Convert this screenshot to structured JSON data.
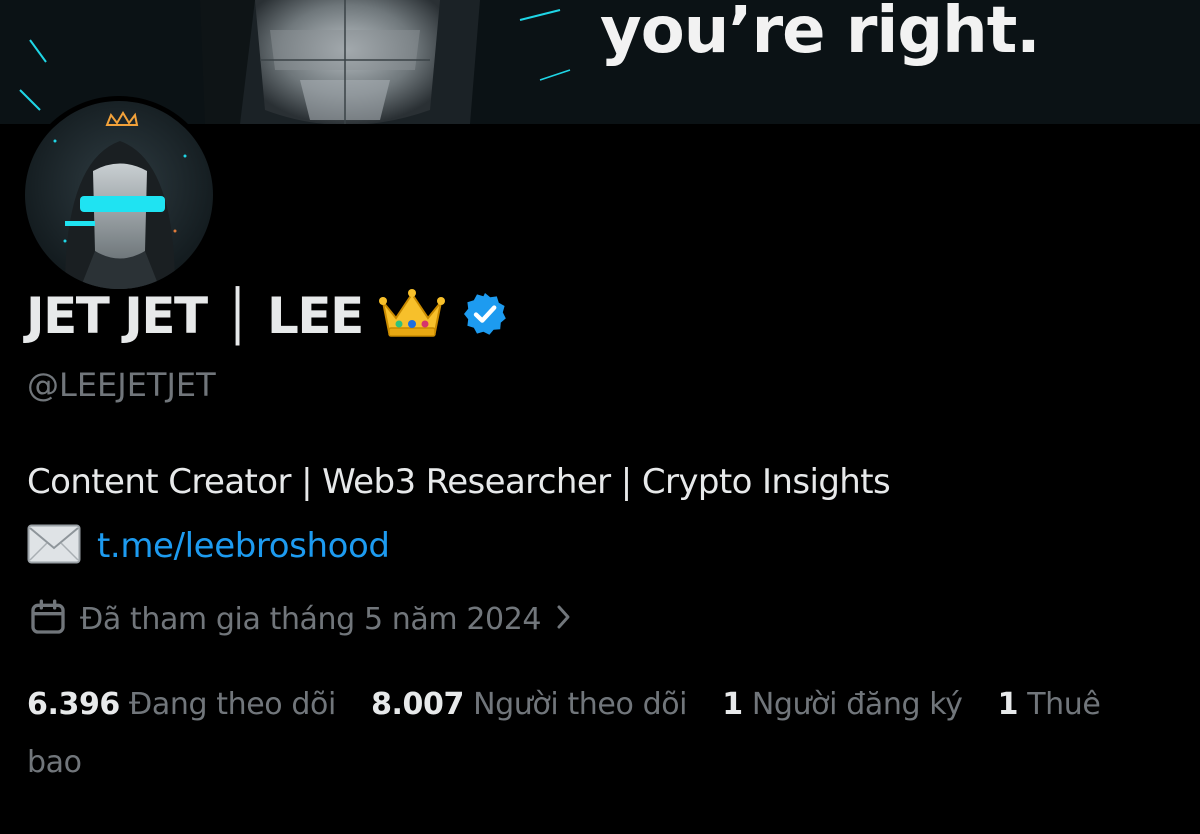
{
  "banner": {
    "text": "you’re right."
  },
  "profile": {
    "display_name": "JET JET │ LEE",
    "name_emoji": "crown-icon",
    "verified_badge": "verified-icon",
    "handle": "@LEEJETJET",
    "bio": "Content Creator | Web3 Researcher | Crypto Insights",
    "link_icon": "mail-icon",
    "link_text": "t.me/leebroshood",
    "joined_icon": "calendar-icon",
    "joined": "Đã tham gia tháng 5 năm 2024"
  },
  "stats": {
    "following_count": "6.396",
    "following_label": "Đang theo dõi",
    "followers_count": "8.007",
    "followers_label": "Người theo dõi",
    "subscribers_count": "1",
    "subscribers_label": "Người đăng ký",
    "subscriptions_count": "1",
    "subscriptions_label": "Thuê bao"
  },
  "colors": {
    "background": "#000000",
    "text_primary": "#e7e9ea",
    "text_secondary": "#71767b",
    "link": "#1d9bf0",
    "verified": "#1d9bf0"
  }
}
